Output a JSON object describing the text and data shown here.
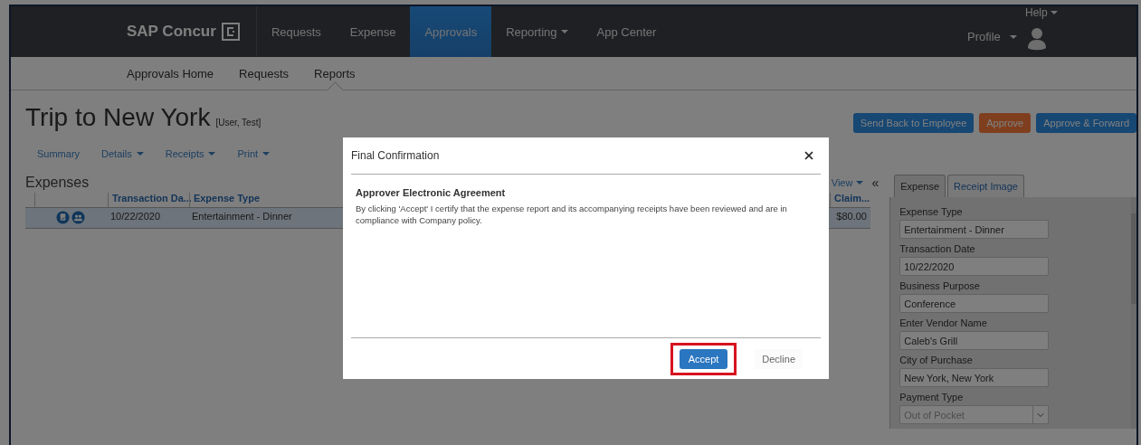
{
  "top_nav": {
    "logo": "SAP Concur",
    "items": [
      {
        "label": "Requests",
        "selected": false,
        "dropdown": false
      },
      {
        "label": "Expense",
        "selected": false,
        "dropdown": false
      },
      {
        "label": "Approvals",
        "selected": true,
        "dropdown": false
      },
      {
        "label": "Reporting",
        "selected": false,
        "dropdown": true
      },
      {
        "label": "App Center",
        "selected": false,
        "dropdown": false
      }
    ],
    "help": "Help",
    "profile": "Profile"
  },
  "sub_nav": [
    {
      "label": "Approvals Home",
      "selected": false
    },
    {
      "label": "Requests",
      "selected": false
    },
    {
      "label": "Reports",
      "selected": true
    }
  ],
  "report": {
    "title": "Trip to New York",
    "owner": "[User, Test]"
  },
  "actions": [
    {
      "label": "Send Back to Employee",
      "kind": "secondary"
    },
    {
      "label": "Approve",
      "kind": "primary"
    },
    {
      "label": "Approve & Forward",
      "kind": "secondary"
    }
  ],
  "report_menu": [
    {
      "label": "Summary",
      "dropdown": false
    },
    {
      "label": "Details",
      "dropdown": true
    },
    {
      "label": "Receipts",
      "dropdown": true
    },
    {
      "label": "Print",
      "dropdown": true
    }
  ],
  "expenses": {
    "title": "Expenses",
    "view": "View",
    "collapse": "«",
    "columns": [
      "Transaction Da...",
      "Expense Type",
      "Claim..."
    ],
    "rows": [
      {
        "date": "10/22/2020",
        "type": "Entertainment - Dinner",
        "amount": "$80.00",
        "selected": true
      }
    ]
  },
  "detail_panel": {
    "tabs": [
      {
        "label": "Expense",
        "selected": true
      },
      {
        "label": "Receipt Image",
        "selected": false
      }
    ],
    "fields": [
      {
        "label": "Expense Type",
        "value": "Entertainment - Dinner",
        "kind": "text",
        "disabled": false
      },
      {
        "label": "Transaction Date",
        "value": "10/22/2020",
        "kind": "text",
        "disabled": false
      },
      {
        "label": "Business Purpose",
        "value": "Conference",
        "kind": "text",
        "disabled": false
      },
      {
        "label": "Enter Vendor Name",
        "value": "Caleb's Grill",
        "kind": "text",
        "disabled": false
      },
      {
        "label": "City of Purchase",
        "value": "New York, New York",
        "kind": "text",
        "disabled": false
      },
      {
        "label": "Payment Type",
        "value": "Out of Pocket",
        "kind": "select",
        "disabled": true
      }
    ]
  },
  "dialog": {
    "title": "Final Confirmation",
    "heading": "Approver Electronic Agreement",
    "message": "By clicking 'Accept' I certify that the expense report and its accompanying receipts have been reviewed and are in compliance with Company policy.",
    "buttons": [
      {
        "label": "Accept",
        "kind": "primary",
        "highlighted": true
      },
      {
        "label": "Decline",
        "kind": "link",
        "highlighted": false
      }
    ]
  }
}
